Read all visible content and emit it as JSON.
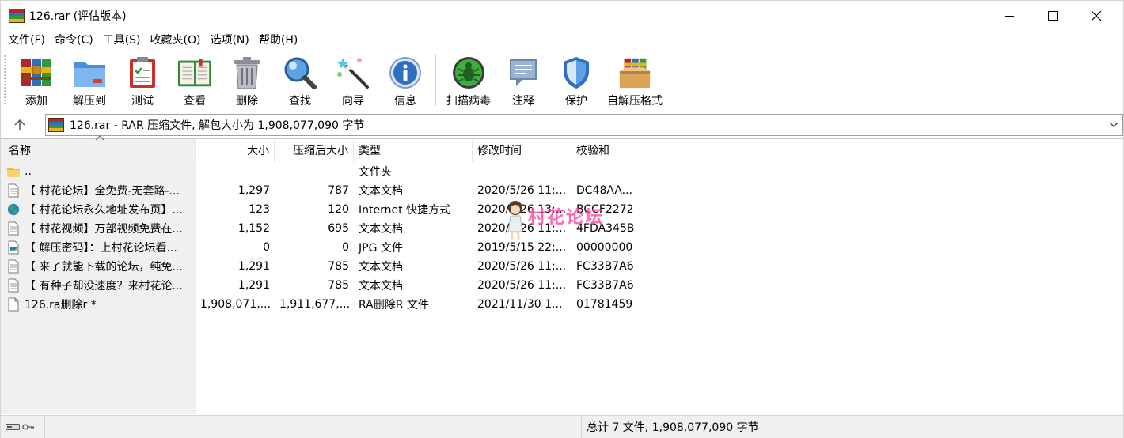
{
  "window": {
    "title": "126.rar (评估版本)"
  },
  "menu": [
    "文件(F)",
    "命令(C)",
    "工具(S)",
    "收藏夹(O)",
    "选项(N)",
    "帮助(H)"
  ],
  "toolbar": {
    "group1": [
      {
        "label": "添加",
        "icon": "add-archive-icon"
      },
      {
        "label": "解压到",
        "icon": "extract-folder-icon"
      },
      {
        "label": "测试",
        "icon": "test-clipboard-icon"
      },
      {
        "label": "查看",
        "icon": "view-book-icon"
      },
      {
        "label": "删除",
        "icon": "delete-trash-icon"
      },
      {
        "label": "查找",
        "icon": "find-magnifier-icon"
      },
      {
        "label": "向导",
        "icon": "wizard-wand-icon"
      },
      {
        "label": "信息",
        "icon": "info-icon"
      }
    ],
    "group2": [
      {
        "label": "扫描病毒",
        "icon": "virus-scan-icon"
      },
      {
        "label": "注释",
        "icon": "comment-icon"
      },
      {
        "label": "保护",
        "icon": "protect-shield-icon"
      },
      {
        "label": "自解压格式",
        "icon": "sfx-box-icon"
      }
    ]
  },
  "address": {
    "text": "126.rar - RAR 压缩文件, 解包大小为 1,908,077,090 字节"
  },
  "columns": {
    "name": "名称",
    "size": "大小",
    "packed": "压缩后大小",
    "type": "类型",
    "modified": "修改时间",
    "crc": "校验和"
  },
  "files": [
    {
      "icon": "folder-icon",
      "name": "..",
      "size": "",
      "packed": "",
      "type": "文件夹",
      "modified": "",
      "crc": ""
    },
    {
      "icon": "text-file-icon",
      "name": "【 村花论坛】全免费-无套路-...",
      "size": "1,297",
      "packed": "787",
      "type": "文本文档",
      "modified": "2020/5/26 11:...",
      "crc": "DC48AA..."
    },
    {
      "icon": "internet-shortcut-icon",
      "name": "【 村花论坛永久地址发布页】...",
      "size": "123",
      "packed": "120",
      "type": "Internet 快捷方式",
      "modified": "2020/5/26 13:...",
      "crc": "BCCF2272"
    },
    {
      "icon": "text-file-icon",
      "name": "【 村花视频】万部视频免费在...",
      "size": "1,152",
      "packed": "695",
      "type": "文本文档",
      "modified": "2020/5/26 11:...",
      "crc": "4FDA345B"
    },
    {
      "icon": "image-file-icon",
      "name": "【 解压密码】：上村花论坛看...",
      "size": "0",
      "packed": "0",
      "type": "JPG 文件",
      "modified": "2019/5/15 22:...",
      "crc": "00000000"
    },
    {
      "icon": "text-file-icon",
      "name": "【 来了就能下载的论坛，纯免...",
      "size": "1,291",
      "packed": "785",
      "type": "文本文档",
      "modified": "2020/5/26 11:...",
      "crc": "FC33B7A6"
    },
    {
      "icon": "text-file-icon",
      "name": "【 有种子却没速度？来村花论...",
      "size": "1,291",
      "packed": "785",
      "type": "文本文档",
      "modified": "2020/5/26 11:...",
      "crc": "FC33B7A6"
    },
    {
      "icon": "blank-file-icon",
      "name": "126.ra删除r *",
      "size": "1,908,071,...",
      "packed": "1,911,677,...",
      "type": "RA删除R 文件",
      "modified": "2021/11/30 1...",
      "crc": "01781459"
    }
  ],
  "watermark": {
    "text": "村花论坛"
  },
  "status": {
    "summary": "总计 7 文件, 1,908,077,090 字节"
  },
  "colors": {
    "pane_bg": "#f0f0f0",
    "watermark": "#ff4fa3"
  }
}
